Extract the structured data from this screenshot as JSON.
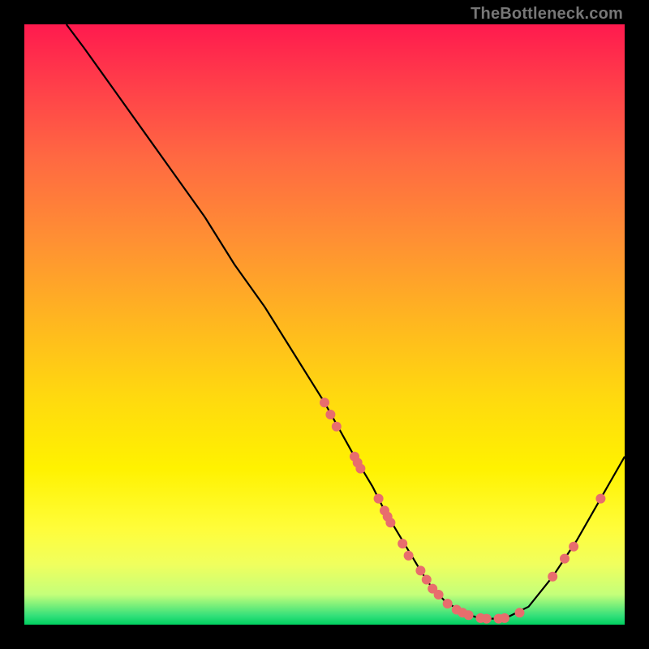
{
  "watermark": "TheBottleneck.com",
  "chart_data": {
    "type": "line",
    "title": "",
    "xlabel": "",
    "ylabel": "",
    "xlim": [
      0,
      100
    ],
    "ylim": [
      0,
      100
    ],
    "grid": false,
    "legend": false,
    "series": [
      {
        "name": "curve",
        "color": "#000000",
        "x": [
          7,
          10,
          15,
          20,
          25,
          30,
          35,
          40,
          45,
          50,
          55,
          58,
          60,
          63,
          66,
          68,
          70,
          73,
          76,
          80,
          84,
          88,
          92,
          96,
          100
        ],
        "y": [
          100,
          96,
          89,
          82,
          75,
          68,
          60,
          53,
          45,
          37,
          28,
          23,
          19,
          14,
          9,
          6,
          4,
          2,
          1,
          1,
          3,
          8,
          14,
          21,
          28
        ]
      }
    ],
    "points": {
      "name": "markers",
      "color": "#e86d6d",
      "radius": 6,
      "xy": [
        [
          50,
          37
        ],
        [
          51,
          35
        ],
        [
          52,
          33
        ],
        [
          55,
          28
        ],
        [
          55.5,
          27
        ],
        [
          56,
          26
        ],
        [
          59,
          21
        ],
        [
          60,
          19
        ],
        [
          60.5,
          18
        ],
        [
          61,
          17
        ],
        [
          63,
          13.5
        ],
        [
          64,
          11.5
        ],
        [
          66,
          9
        ],
        [
          67,
          7.5
        ],
        [
          68,
          6
        ],
        [
          69,
          5
        ],
        [
          70.5,
          3.5
        ],
        [
          72,
          2.5
        ],
        [
          73,
          2
        ],
        [
          74,
          1.6
        ],
        [
          76,
          1.1
        ],
        [
          77,
          1
        ],
        [
          79,
          1
        ],
        [
          80,
          1.1
        ],
        [
          82.5,
          2
        ],
        [
          88,
          8
        ],
        [
          90,
          11
        ],
        [
          91.5,
          13
        ],
        [
          96,
          21
        ]
      ]
    }
  }
}
